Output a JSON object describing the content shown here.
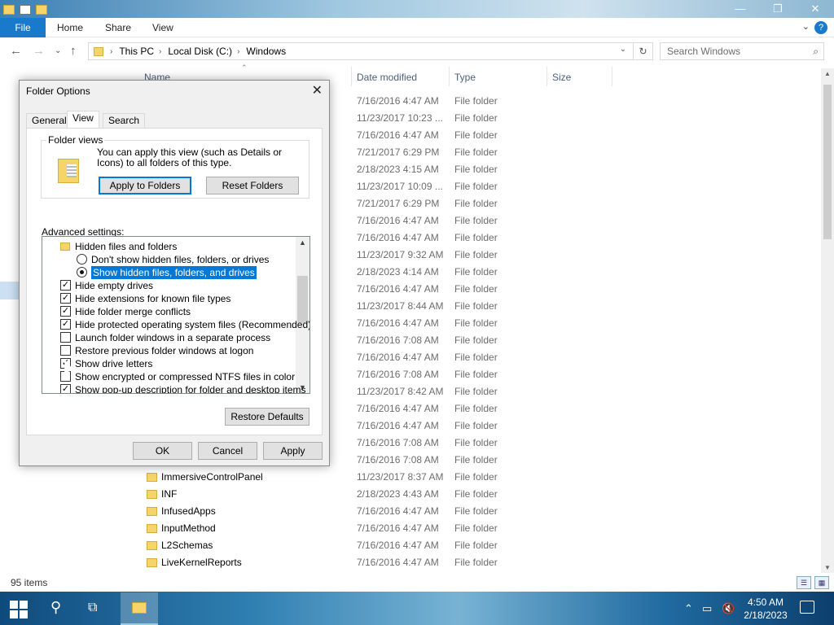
{
  "window": {
    "title": "Windows"
  },
  "ribbon": {
    "file": "File",
    "tabs": [
      "Home",
      "Share",
      "View"
    ],
    "help": "?"
  },
  "address": {
    "crumbs": [
      "This PC",
      "Local Disk (C:)",
      "Windows"
    ],
    "search_placeholder": "Search Windows"
  },
  "columns": {
    "name": "Name",
    "date": "Date modified",
    "type": "Type",
    "size": "Size"
  },
  "files": [
    {
      "name": "",
      "date": "7/16/2016 4:47 AM",
      "type": "File folder"
    },
    {
      "name": "",
      "date": "11/23/2017 10:23 ...",
      "type": "File folder"
    },
    {
      "name": "",
      "date": "7/16/2016 4:47 AM",
      "type": "File folder"
    },
    {
      "name": "",
      "date": "7/21/2017 6:29 PM",
      "type": "File folder"
    },
    {
      "name": "",
      "date": "2/18/2023 4:15 AM",
      "type": "File folder"
    },
    {
      "name": "",
      "date": "11/23/2017 10:09 ...",
      "type": "File folder"
    },
    {
      "name": "",
      "date": "7/21/2017 6:29 PM",
      "type": "File folder"
    },
    {
      "name": "",
      "date": "7/16/2016 4:47 AM",
      "type": "File folder"
    },
    {
      "name": "",
      "date": "7/16/2016 4:47 AM",
      "type": "File folder"
    },
    {
      "name": "",
      "date": "11/23/2017 9:32 AM",
      "type": "File folder"
    },
    {
      "name": "",
      "date": "2/18/2023 4:14 AM",
      "type": "File folder"
    },
    {
      "name": "",
      "date": "7/16/2016 4:47 AM",
      "type": "File folder"
    },
    {
      "name": "",
      "date": "11/23/2017 8:44 AM",
      "type": "File folder"
    },
    {
      "name": "",
      "date": "7/16/2016 4:47 AM",
      "type": "File folder"
    },
    {
      "name": "",
      "date": "7/16/2016 7:08 AM",
      "type": "File folder"
    },
    {
      "name": "",
      "date": "7/16/2016 4:47 AM",
      "type": "File folder"
    },
    {
      "name": "",
      "date": "7/16/2016 7:08 AM",
      "type": "File folder"
    },
    {
      "name": "",
      "date": "11/23/2017 8:42 AM",
      "type": "File folder"
    },
    {
      "name": "",
      "date": "7/16/2016 4:47 AM",
      "type": "File folder"
    },
    {
      "name": "",
      "date": "7/16/2016 4:47 AM",
      "type": "File folder"
    },
    {
      "name": "",
      "date": "7/16/2016 7:08 AM",
      "type": "File folder"
    },
    {
      "name": "",
      "date": "7/16/2016 7:08 AM",
      "type": "File folder"
    },
    {
      "name": "ImmersiveControlPanel",
      "date": "11/23/2017 8:37 AM",
      "type": "File folder"
    },
    {
      "name": "INF",
      "date": "2/18/2023 4:43 AM",
      "type": "File folder"
    },
    {
      "name": "InfusedApps",
      "date": "7/16/2016 4:47 AM",
      "type": "File folder"
    },
    {
      "name": "InputMethod",
      "date": "7/16/2016 4:47 AM",
      "type": "File folder"
    },
    {
      "name": "L2Schemas",
      "date": "7/16/2016 4:47 AM",
      "type": "File folder"
    },
    {
      "name": "LiveKernelReports",
      "date": "7/16/2016 4:47 AM",
      "type": "File folder"
    }
  ],
  "status": {
    "items": "95 items"
  },
  "dialog": {
    "title": "Folder Options",
    "tabs": [
      "General",
      "View",
      "Search"
    ],
    "folder_views": {
      "legend": "Folder views",
      "text": "You can apply this view (such as Details or Icons) to all folders of this type.",
      "apply": "Apply to Folders",
      "reset": "Reset Folders"
    },
    "advanced_label": "Advanced settings:",
    "settings": [
      {
        "kind": "folder",
        "label": "Hidden files and folders",
        "indent": 0
      },
      {
        "kind": "radio",
        "checked": false,
        "label": "Don't show hidden files, folders, or drives",
        "indent": 1
      },
      {
        "kind": "radio",
        "checked": true,
        "selected": true,
        "label": "Show hidden files, folders, and drives",
        "indent": 1
      },
      {
        "kind": "check",
        "checked": true,
        "label": "Hide empty drives",
        "indent": 0
      },
      {
        "kind": "check",
        "checked": true,
        "label": "Hide extensions for known file types",
        "indent": 0
      },
      {
        "kind": "check",
        "checked": true,
        "label": "Hide folder merge conflicts",
        "indent": 0
      },
      {
        "kind": "check",
        "checked": true,
        "label": "Hide protected operating system files (Recommended)",
        "indent": 0
      },
      {
        "kind": "check",
        "checked": false,
        "label": "Launch folder windows in a separate process",
        "indent": 0
      },
      {
        "kind": "check",
        "checked": false,
        "label": "Restore previous folder windows at logon",
        "indent": 0
      },
      {
        "kind": "check",
        "checked": true,
        "label": "Show drive letters",
        "indent": 0
      },
      {
        "kind": "check",
        "checked": false,
        "label": "Show encrypted or compressed NTFS files in color",
        "indent": 0
      },
      {
        "kind": "check",
        "checked": true,
        "label": "Show pop-up description for folder and desktop items",
        "indent": 0
      }
    ],
    "restore": "Restore Defaults",
    "ok": "OK",
    "cancel": "Cancel",
    "apply": "Apply"
  },
  "taskbar": {
    "time": "4:50 AM",
    "date": "2/18/2023"
  }
}
